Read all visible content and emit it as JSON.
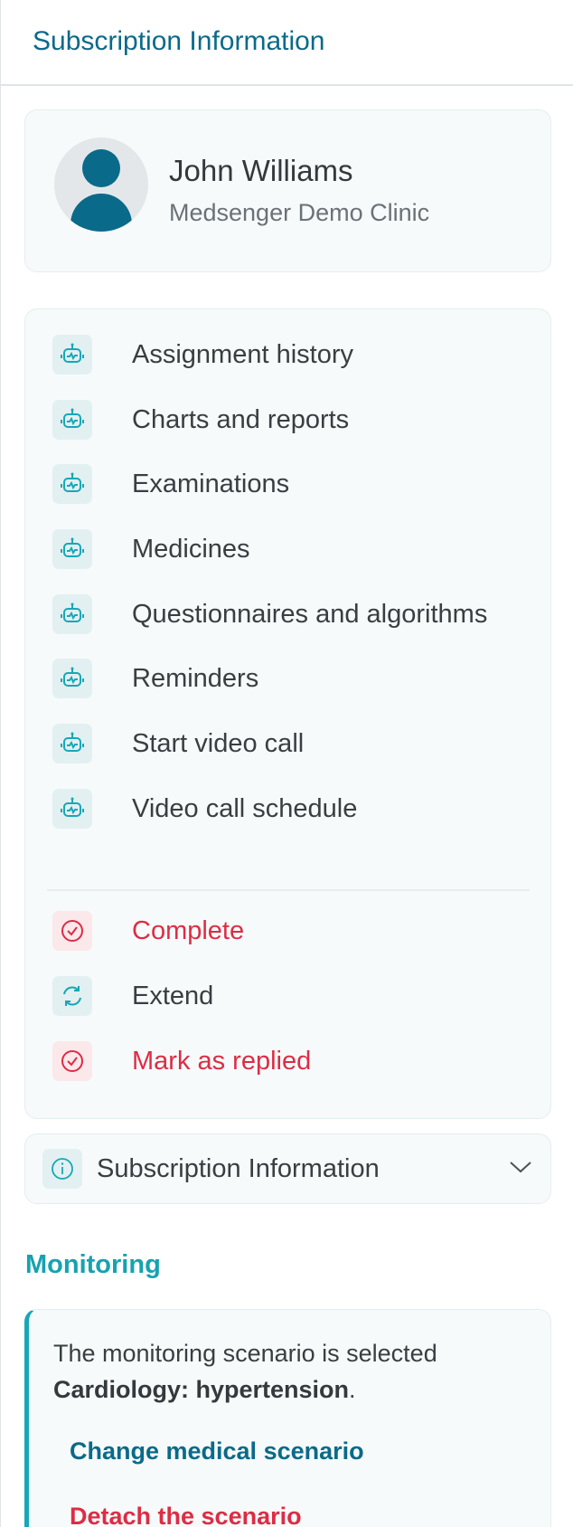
{
  "header": {
    "title": "Subscription Information"
  },
  "profile": {
    "name": "John Williams",
    "clinic": "Medsenger Demo Clinic"
  },
  "menu": {
    "items": [
      {
        "label": "Assignment history",
        "icon": "robot-icon"
      },
      {
        "label": "Charts and reports",
        "icon": "robot-icon"
      },
      {
        "label": "Examinations",
        "icon": "robot-icon"
      },
      {
        "label": "Medicines",
        "icon": "robot-icon"
      },
      {
        "label": "Questionnaires and algorithms",
        "icon": "robot-icon"
      },
      {
        "label": "Reminders",
        "icon": "robot-icon"
      },
      {
        "label": "Start video call",
        "icon": "robot-icon"
      },
      {
        "label": "Video call schedule",
        "icon": "robot-icon"
      }
    ],
    "actions": [
      {
        "label": "Complete",
        "icon": "check-circle-icon",
        "style": "danger"
      },
      {
        "label": "Extend",
        "icon": "refresh-icon",
        "style": "normal"
      },
      {
        "label": "Mark as replied",
        "icon": "check-circle-icon",
        "style": "danger"
      }
    ]
  },
  "info_panel": {
    "label": "Subscription Information",
    "icon": "info-icon",
    "expand_icon": "chevron-down-icon"
  },
  "monitoring": {
    "title": "Monitoring",
    "text": "The monitoring scenario is selected",
    "scenario": "Cardiology: hypertension",
    "period": ".",
    "change_label": "Change medical scenario",
    "detach_label": "Detach the scenario"
  },
  "colors": {
    "accent": "#0a6a89",
    "teal": "#18a7b6",
    "danger": "#dc2d45",
    "text": "#383e42",
    "muted": "#6a7278"
  }
}
